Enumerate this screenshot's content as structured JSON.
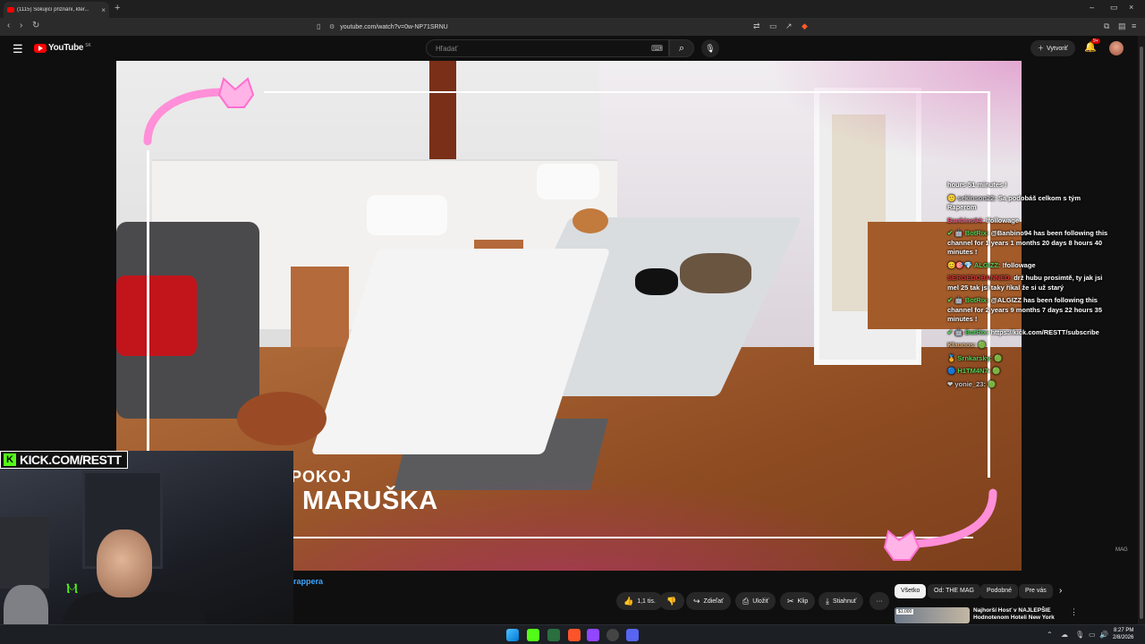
{
  "browser": {
    "tab_title": "(1115) Šokující přiznání, kter...",
    "tab_close": "×",
    "new_tab": "+",
    "url": "youtube.com/watch?v=0w-NP71SRNU",
    "win_min": "–",
    "win_max": "▭",
    "win_close": "×"
  },
  "youtube": {
    "logo": "YouTube",
    "country": "SK",
    "search_placeholder": "Hľadať",
    "create_label": "Vytvoriť",
    "notif_badge": "9+",
    "brand_color": "#ff0000"
  },
  "video": {
    "overlay_top": "POKOJ",
    "overlay_name": "MARUŠKA",
    "watermark": "MAG",
    "kick_label": "KICK.COM/RESTT"
  },
  "chat": [
    {
      "user": "",
      "text": "hours 51 minutes !",
      "cls": ""
    },
    {
      "user": "🙂 sekinson22:",
      "text": "Sa podobáš celkom s tým Raperom",
      "cls": "gray"
    },
    {
      "user": "Banbino94:",
      "text": "!followage",
      "cls": "pink"
    },
    {
      "user": "✔ 🤖 BotRix:",
      "text": "@Banbino94 has been following this channel for 1 years 1 months 20 days 8 hours 40 minutes !",
      "cls": ""
    },
    {
      "user": "😊🎯💎 ALGIZZ:",
      "text": "!followage",
      "cls": ""
    },
    {
      "user": "SERGEDOBANNED:",
      "text": "drž hubu prosimtě, ty jak jsi mel 25 tak jsi taky říkal že si už starý",
      "cls": "red"
    },
    {
      "user": "✔ 🤖 BotRix:",
      "text": "@ALGIZZ has been following this channel for 2 years 9 months 7 days 22 hours 35 minutes !",
      "cls": ""
    },
    {
      "user": "✔ 🤖 BotRix:",
      "text": "https://kick.com/RESTT/subscribe",
      "cls": ""
    },
    {
      "user": "Klaunos:",
      "text": "🟢",
      "cls": "tan"
    },
    {
      "user": "🏅 Srnkarsky:",
      "text": "🟢",
      "cls": ""
    },
    {
      "user": "🔵 H1TM4N7:",
      "text": "🟢",
      "cls": ""
    },
    {
      "user": "❤ yonie_23:",
      "text": "🟢",
      "cls": "gray"
    }
  ],
  "below": {
    "channel_text": "rappera",
    "like_count": "1,1 tis.",
    "share_label": "Zdieľať",
    "save_label": "Uložiť",
    "clip_label": "Klip",
    "download_label": "Stiahnuť",
    "more_label": "···",
    "chips": [
      "Všetko",
      "Od: THE MAG",
      "Podobné",
      "Pre vás"
    ],
    "rec_title": "Najhorší Hosť v NAJLEPŠIE Hodnotenom Hoteli New York",
    "rec_price": "$1,000"
  },
  "taskbar": {
    "time": "8:27 PM",
    "date": "2/8/2026"
  },
  "icons": [
    "menu-icon",
    "search-icon",
    "mic-icon",
    "keyboard-icon",
    "bell-icon",
    "like-icon",
    "dislike-icon",
    "share-icon",
    "save-icon",
    "clip-icon",
    "download-icon",
    "back-icon",
    "forward-icon",
    "reload-icon"
  ]
}
